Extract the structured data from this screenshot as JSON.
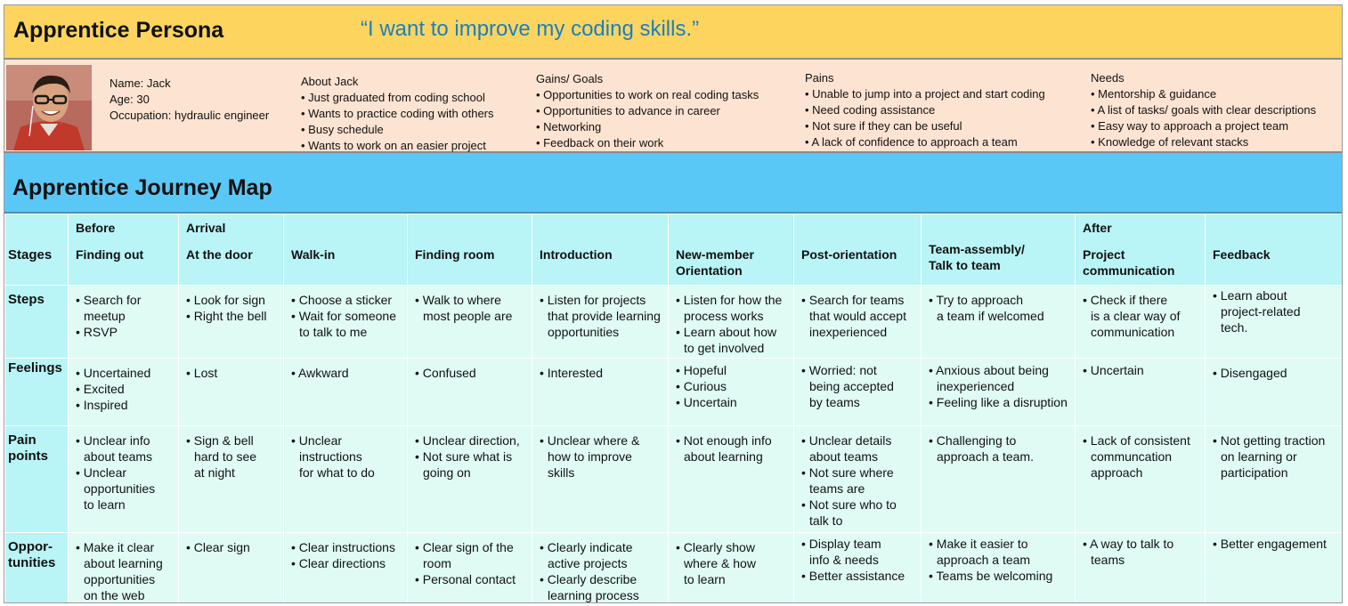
{
  "persona": {
    "title": "Apprentice Persona",
    "quote": "“I want to improve my coding skills.”",
    "avatar_icon": "person-photo",
    "info": [
      "Name: Jack",
      "Age: 30",
      "Occupation: hydraulic engineer"
    ],
    "about": {
      "heading": "About Jack",
      "items": [
        "• Just graduated from coding school",
        "• Wants to practice coding with others",
        "• Busy schedule",
        "• Wants to work on an easier project"
      ]
    },
    "gains": {
      "heading": "Gains/ Goals",
      "items": [
        "• Opportunities to work on real coding tasks",
        "• Opportunities to advance in career",
        "• Networking",
        "• Feedback on their work"
      ]
    },
    "pains": {
      "heading": "Pains",
      "items": [
        "• Unable to jump into a project and start coding",
        "• Need coding assistance",
        "• Not sure if they can be useful",
        "• A lack of confidence to approach a team"
      ]
    },
    "needs": {
      "heading": "Needs",
      "items": [
        "• Mentorship & guidance",
        "• A list of tasks/ goals with clear descriptions",
        "• Easy way to approach a project team",
        "• Knowledge of relevant stacks"
      ]
    }
  },
  "journey": {
    "title": "Apprentice Journey Map",
    "phases": {
      "before": "Before",
      "arrival": "Arrival",
      "after": "After"
    },
    "row_labels": {
      "stages": "Stages",
      "steps": "Steps",
      "feelings": "Feelings",
      "pain_points": [
        "Pain",
        "points"
      ],
      "opportunities": [
        "Oppor-",
        "tunities"
      ]
    },
    "stages": [
      [
        "Finding out"
      ],
      [
        "At the door"
      ],
      [
        "Walk-in"
      ],
      [
        "Finding room"
      ],
      [
        "Introduction"
      ],
      [
        "New-member",
        "Orientation"
      ],
      [
        "Post-orientation"
      ],
      [
        "Team-assembly/",
        "Talk to team"
      ],
      [
        "Project",
        "communication"
      ],
      [
        "Feedback"
      ]
    ],
    "steps": [
      [
        "• Search for",
        "meetup",
        "• RSVP"
      ],
      [
        "• Look for sign",
        "• Right the bell"
      ],
      [
        "• Choose a sticker",
        "• Wait for someone",
        "to talk to me"
      ],
      [
        "• Walk to where",
        "most people are"
      ],
      [
        "• Listen for projects",
        "that provide learning",
        "opportunities"
      ],
      [
        "• Listen for how the",
        "process works",
        "• Learn about how",
        "to get involved"
      ],
      [
        "• Search for teams",
        "that would accept",
        "inexperienced"
      ],
      [
        "• Try to approach",
        "a team if welcomed"
      ],
      [
        "• Check if there",
        "is a clear way of",
        "communication"
      ],
      [
        "• Learn about",
        "project-related",
        "tech."
      ]
    ],
    "feelings": [
      [
        "• Uncertained",
        "• Excited",
        "• Inspired"
      ],
      [
        "• Lost"
      ],
      [
        "• Awkward"
      ],
      [
        "• Confused"
      ],
      [
        "• Interested"
      ],
      [
        "• Hopeful",
        "• Curious",
        "• Uncertain"
      ],
      [
        "• Worried: not",
        "being accepted",
        "by teams"
      ],
      [
        "• Anxious about being",
        "inexperienced",
        "• Feeling like a disruption"
      ],
      [
        "• Uncertain"
      ],
      [
        "• Disengaged"
      ]
    ],
    "pain_points": [
      [
        "• Unclear info",
        "about teams",
        "• Unclear",
        "opportunities",
        "to learn"
      ],
      [
        "• Sign & bell",
        "hard to see",
        "at night"
      ],
      [
        "• Unclear",
        "instructions",
        "for what to do"
      ],
      [
        "• Unclear direction,",
        "• Not sure what is",
        "going on"
      ],
      [
        "• Unclear where &",
        "how to improve",
        "skills"
      ],
      [
        "• Not enough info",
        "about learning"
      ],
      [
        "• Unclear details",
        "about teams",
        "• Not sure where",
        "teams are",
        "• Not sure who to",
        "talk to"
      ],
      [
        "• Challenging to",
        "approach a team."
      ],
      [
        "• Lack of consistent",
        "communcation",
        "approach"
      ],
      [
        "• Not getting traction",
        "on learning or",
        "participation"
      ]
    ],
    "opportunities": [
      [
        "• Make it clear",
        "about learning",
        "opportunities",
        "on the web"
      ],
      [
        "• Clear sign"
      ],
      [
        "• Clear instructions",
        "• Clear directions"
      ],
      [
        "• Clear sign of the",
        "room",
        "• Personal contact"
      ],
      [
        "• Clearly indicate",
        "active projects",
        "• Clearly describe",
        "learning process"
      ],
      [
        "• Clearly show",
        "where & how",
        "to learn"
      ],
      [
        "• Display team",
        "info & needs",
        "• Better assistance"
      ],
      [
        "• Make it easier to",
        "approach a team",
        "• Teams be welcoming"
      ],
      [
        "• A way to talk to",
        "teams"
      ],
      [
        "• Better engagement"
      ]
    ]
  }
}
